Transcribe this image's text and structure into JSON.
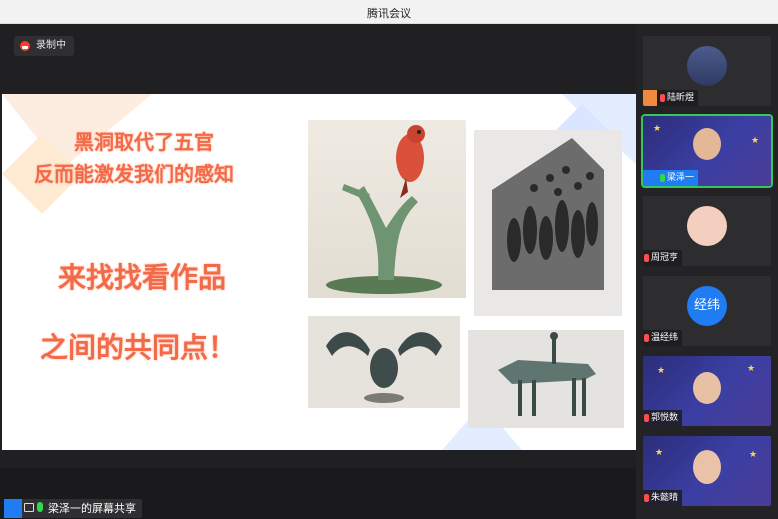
{
  "window": {
    "title": "腾讯会议"
  },
  "recording": {
    "label": "录制中"
  },
  "slide": {
    "line1": "黑洞取代了五官",
    "line2": "反而能激发我们的感知",
    "line3": "来找找看作品",
    "line4": "之间的共同点！"
  },
  "share_bar": {
    "label": "梁泽一的屏幕共享"
  },
  "participants": [
    {
      "name": "陆昕煜",
      "avatar_text": ""
    },
    {
      "name": "梁泽一",
      "avatar_text": ""
    },
    {
      "name": "周冠亨",
      "avatar_text": ""
    },
    {
      "name": "温经纬",
      "avatar_text": "经纬"
    },
    {
      "name": "郭悦数",
      "avatar_text": ""
    },
    {
      "name": "朱懿晴",
      "avatar_text": ""
    }
  ],
  "colors": {
    "accent": "#1f7cf2",
    "active_speaker": "#35c759",
    "slide_text": "#f36a4a"
  }
}
